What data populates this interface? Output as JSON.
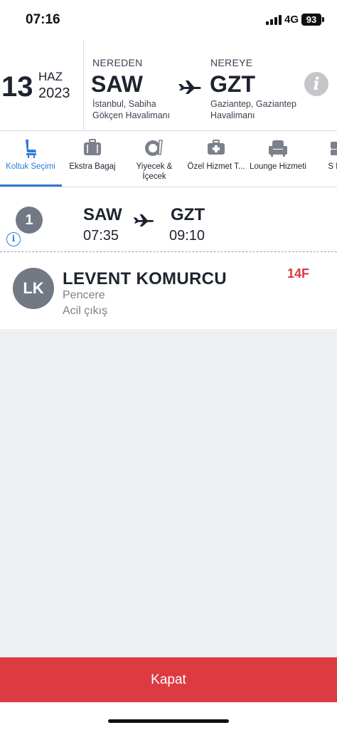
{
  "status": {
    "time": "07:16",
    "network": "4G",
    "battery": "93"
  },
  "flight": {
    "day": "13",
    "month": "HAZ",
    "year": "2023",
    "from_label": "NEREDEN",
    "from_code": "SAW",
    "from_name": "İstanbul, Sabiha Gökçen Havalimanı",
    "to_label": "NEREYE",
    "to_code": "GZT",
    "to_name": "Gaziantep, Gaziantep Havalimanı"
  },
  "tabs": [
    {
      "label": "Koltuk Seçimi",
      "icon": "seat-icon",
      "active": true
    },
    {
      "label": "Ekstra Bagaj",
      "icon": "luggage-icon"
    },
    {
      "label": "Yiyecek & İçecek",
      "icon": "food-drink-icon"
    },
    {
      "label": "Özel Hizmet T...",
      "icon": "special-service-icon"
    },
    {
      "label": "Lounge Hizmeti",
      "icon": "lounge-icon"
    },
    {
      "label": "S Ekip",
      "icon": "extra-icon"
    }
  ],
  "segment": {
    "number": "1",
    "from_code": "SAW",
    "from_time": "07:35",
    "to_code": "GZT",
    "to_time": "09:10"
  },
  "passenger": {
    "initials": "LK",
    "name": "LEVENT KOMURCU",
    "seat_type": "Pencere",
    "exit": "Acil çıkış",
    "seat": "14F"
  },
  "footer": {
    "close_label": "Kapat"
  },
  "colors": {
    "accent": "#2f7bd6",
    "danger": "#dc3b42",
    "seat": "#d93a40"
  }
}
